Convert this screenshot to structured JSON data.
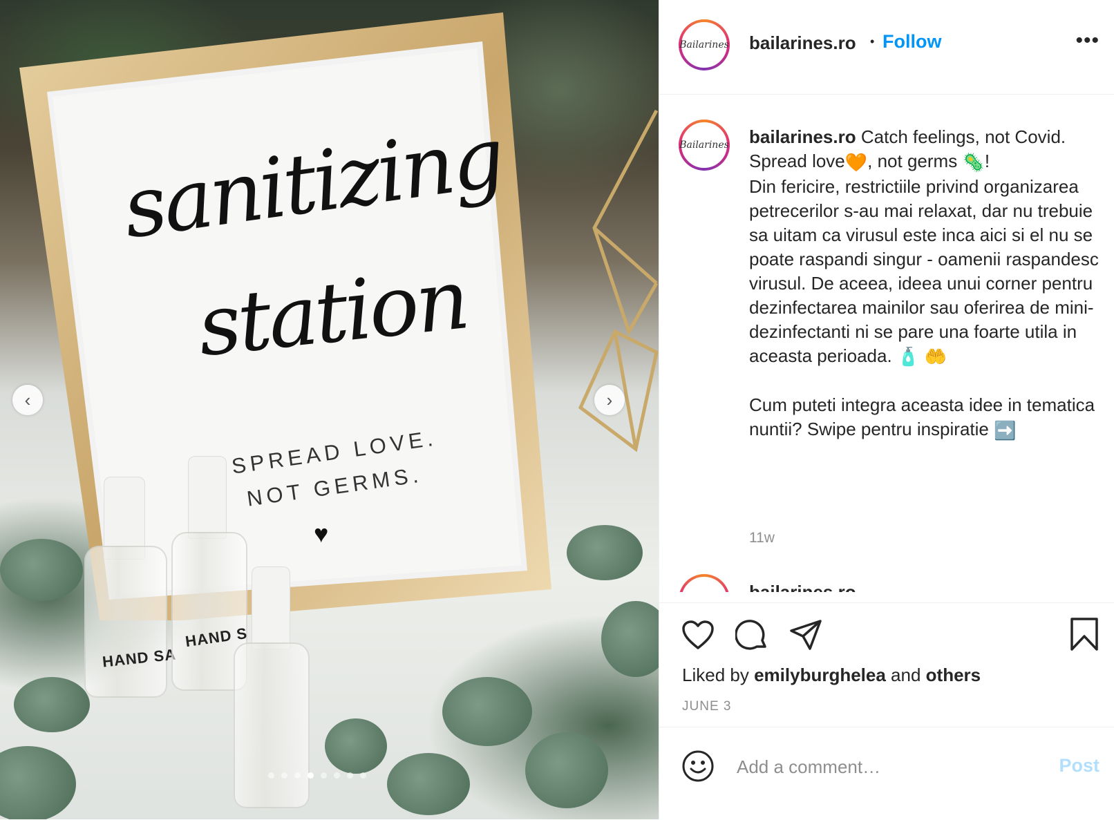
{
  "post": {
    "username": "bailarines.ro",
    "follow_label": "Follow",
    "separator": "•",
    "avatar_logo": "Bailarines",
    "more_label": "•••"
  },
  "media": {
    "sign_script_line1": "sanitizing",
    "sign_script_line2": "station",
    "sign_caps_line1": "SPREAD LOVE.",
    "sign_caps_line2": "NOT GERMS.",
    "sign_heart": "♥",
    "bottle_label": "HAND SA",
    "bottle_label2": "HAND S",
    "prev_icon": "chevron-left-icon",
    "next_icon": "chevron-right-icon",
    "prev_glyph": "‹",
    "next_glyph": "›",
    "slide_count": 8,
    "active_slide": 4
  },
  "caption": {
    "username": "bailarines.ro",
    "line1": "Catch feelings, not Covid.",
    "line2_a": "Spread love",
    "line2_b": ", not germs",
    "line2_c": "!",
    "emoji_heart": "🧡",
    "emoji_virus": "🦠",
    "body": "Din fericire, restrictiile privind organizarea petrecerilor s-au mai relaxat, dar nu trebuie sa uitam ca virusul este inca aici si el nu se poate raspandi singur - oamenii raspandesc virusul. De aceea, ideea unui corner pentru dezinfectarea mainilor sau oferirea de mini-dezinfectanti ni se pare una foarte utila in aceasta perioada.",
    "emoji_lotion": "🧴",
    "emoji_hands": "🤲",
    "para2": "Cum puteti integra aceasta idee in tematica nuntii? Swipe pentru inspiratie",
    "emoji_arrow": "➡️",
    "age": "11w",
    "next_comment_user": "bailarines.ro"
  },
  "actions": {
    "like_icon": "heart-icon",
    "comment_icon": "comment-icon",
    "share_icon": "share-icon",
    "save_icon": "bookmark-icon",
    "liked_by_prefix": "Liked by",
    "liked_by_user": "emilyburghelea",
    "liked_by_and": "and",
    "liked_by_others": "others",
    "date": "JUNE 3"
  },
  "comment": {
    "emoji_icon": "smiley-icon",
    "placeholder": "Add a comment…",
    "post_label": "Post"
  },
  "colors": {
    "accent": "#0095f6",
    "post_disabled": "#b2dffc",
    "muted": "#8e8e8e",
    "text": "#262626"
  }
}
